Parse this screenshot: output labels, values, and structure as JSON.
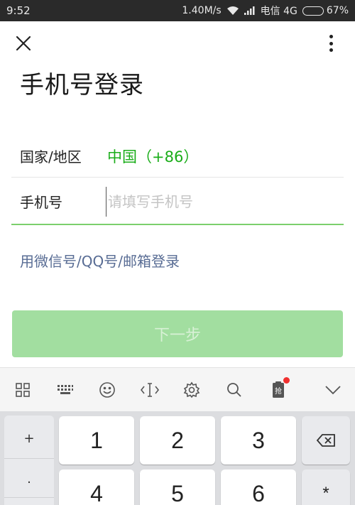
{
  "status_bar": {
    "time": "9:52",
    "speed": "1.40M/s",
    "carrier": "电信 4G",
    "battery": "67%",
    "battery_level": 0.67
  },
  "page": {
    "title": "手机号登录"
  },
  "form": {
    "country_label": "国家/地区",
    "country_value": "中国（+86）",
    "phone_label": "手机号",
    "phone_placeholder": "请填写手机号",
    "phone_value": ""
  },
  "alt_login": "用微信号/QQ号/邮箱登录",
  "next_button": "下一步",
  "keyboard": {
    "toolbar_icons": [
      "grid-icon",
      "keyboard-icon",
      "emoji-icon",
      "cursor-icon",
      "settings-icon",
      "search-icon",
      "clipboard-icon",
      "collapse-icon"
    ],
    "clipboard_badge": "抢",
    "symbols": [
      "+",
      "."
    ],
    "digits_row1": [
      "1",
      "2",
      "3"
    ],
    "digits_row2": [
      "4",
      "5",
      "6"
    ],
    "star": "*"
  }
}
